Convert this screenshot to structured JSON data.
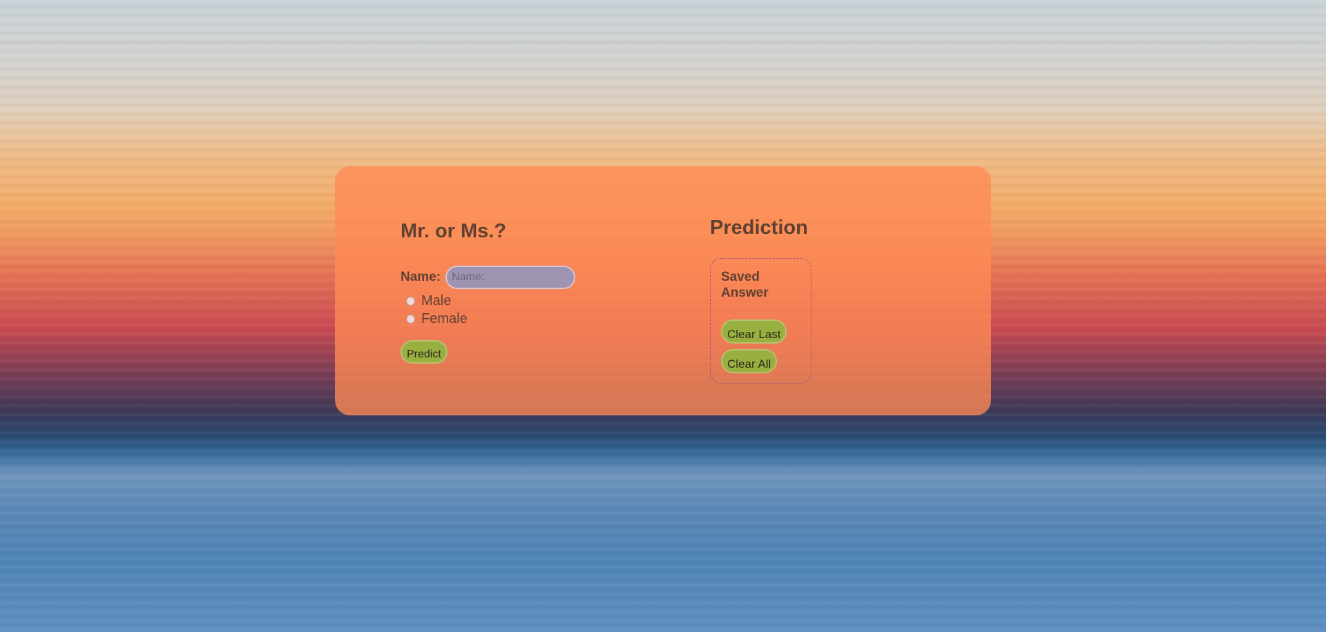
{
  "form": {
    "title": "Mr. or Ms.?",
    "name_label": "Name:",
    "name_value": "",
    "name_placeholder": "Name:",
    "gender_options": [
      {
        "label": "Male",
        "selected": false
      },
      {
        "label": "Female",
        "selected": false
      }
    ],
    "predict_label": "Predict"
  },
  "prediction": {
    "title": "Prediction",
    "saved_answer_title": "Saved Answer",
    "clear_last_label": "Clear Last",
    "clear_all_label": "Clear All"
  },
  "colors": {
    "card_bg": "#ff8a54",
    "heading": "#5f4132",
    "button_bg": "#97b040",
    "input_bg": "#9e93b0",
    "saved_border": "#a24f88"
  }
}
